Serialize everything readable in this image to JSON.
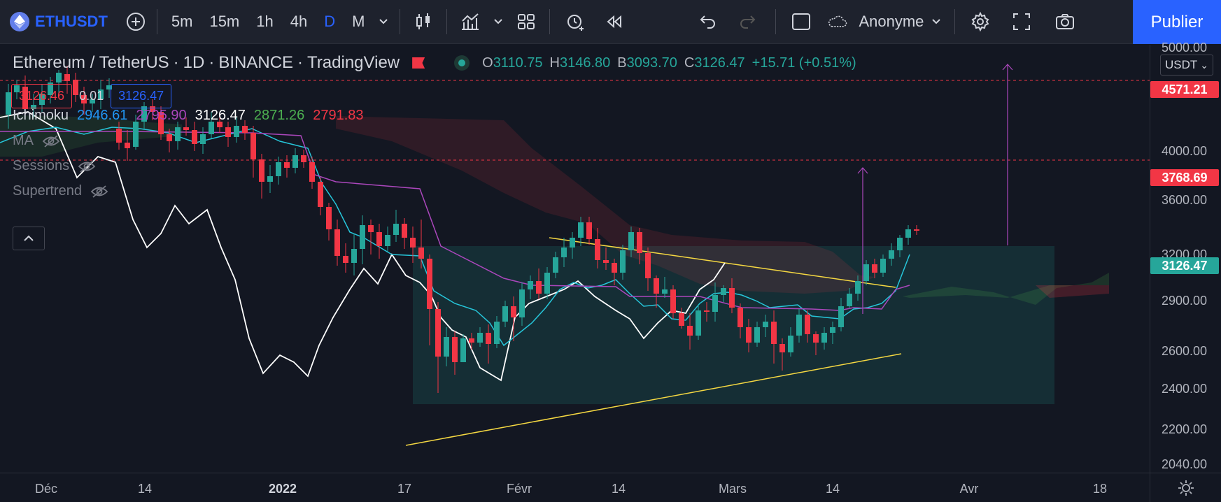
{
  "toolbar": {
    "symbol": "ETHUSDT",
    "intervals": [
      "5m",
      "15m",
      "1h",
      "4h",
      "D",
      "M"
    ],
    "active_interval": "D",
    "layout_name": "Anonyme",
    "publish_label": "Publier"
  },
  "legend": {
    "pair": "Ethereum / TetherUS",
    "timeframe": "1D",
    "exchange": "BINANCE",
    "source": "TradingView",
    "open_label": "O",
    "open": "3110.75",
    "high_label": "H",
    "high": "3146.80",
    "low_label": "B",
    "low": "3093.70",
    "close_label": "C",
    "close": "3126.47",
    "change": "+15.71 (+0.51%)"
  },
  "order": {
    "sell": "3126.46",
    "spread": "0.01",
    "buy": "3126.47"
  },
  "indicators": {
    "ichimoku": {
      "name": "Ichimoku",
      "values": [
        "2946.61",
        "2795.90",
        "3126.47",
        "2871.26",
        "2791.83"
      ]
    },
    "ma": {
      "name": "MA"
    },
    "sessions": {
      "name": "Sessions"
    },
    "supertrend": {
      "name": "Supertrend"
    }
  },
  "price_axis": {
    "currency": "USDT",
    "labels": [
      "5000.00",
      "4000.00",
      "3600.00",
      "3200.00",
      "2900.00",
      "2600.00",
      "2400.00",
      "2200.00",
      "2040.00"
    ],
    "tags": [
      {
        "value": "4571.21",
        "color": "#f23645"
      },
      {
        "value": "3768.69",
        "color": "#f23645"
      },
      {
        "value": "3126.47",
        "color": "#26a69a"
      }
    ]
  },
  "time_axis": {
    "labels": [
      {
        "text": "Déc",
        "bold": false
      },
      {
        "text": "14",
        "bold": false
      },
      {
        "text": "2022",
        "bold": true
      },
      {
        "text": "17",
        "bold": false
      },
      {
        "text": "Févr",
        "bold": false
      },
      {
        "text": "14",
        "bold": false
      },
      {
        "text": "Mars",
        "bold": false
      },
      {
        "text": "14",
        "bold": false
      },
      {
        "text": "Avr",
        "bold": false
      },
      {
        "text": "18",
        "bold": false
      }
    ]
  },
  "colors": {
    "up": "#26a69a",
    "down": "#f23645",
    "accent": "#2962ff",
    "background": "#131722"
  }
}
